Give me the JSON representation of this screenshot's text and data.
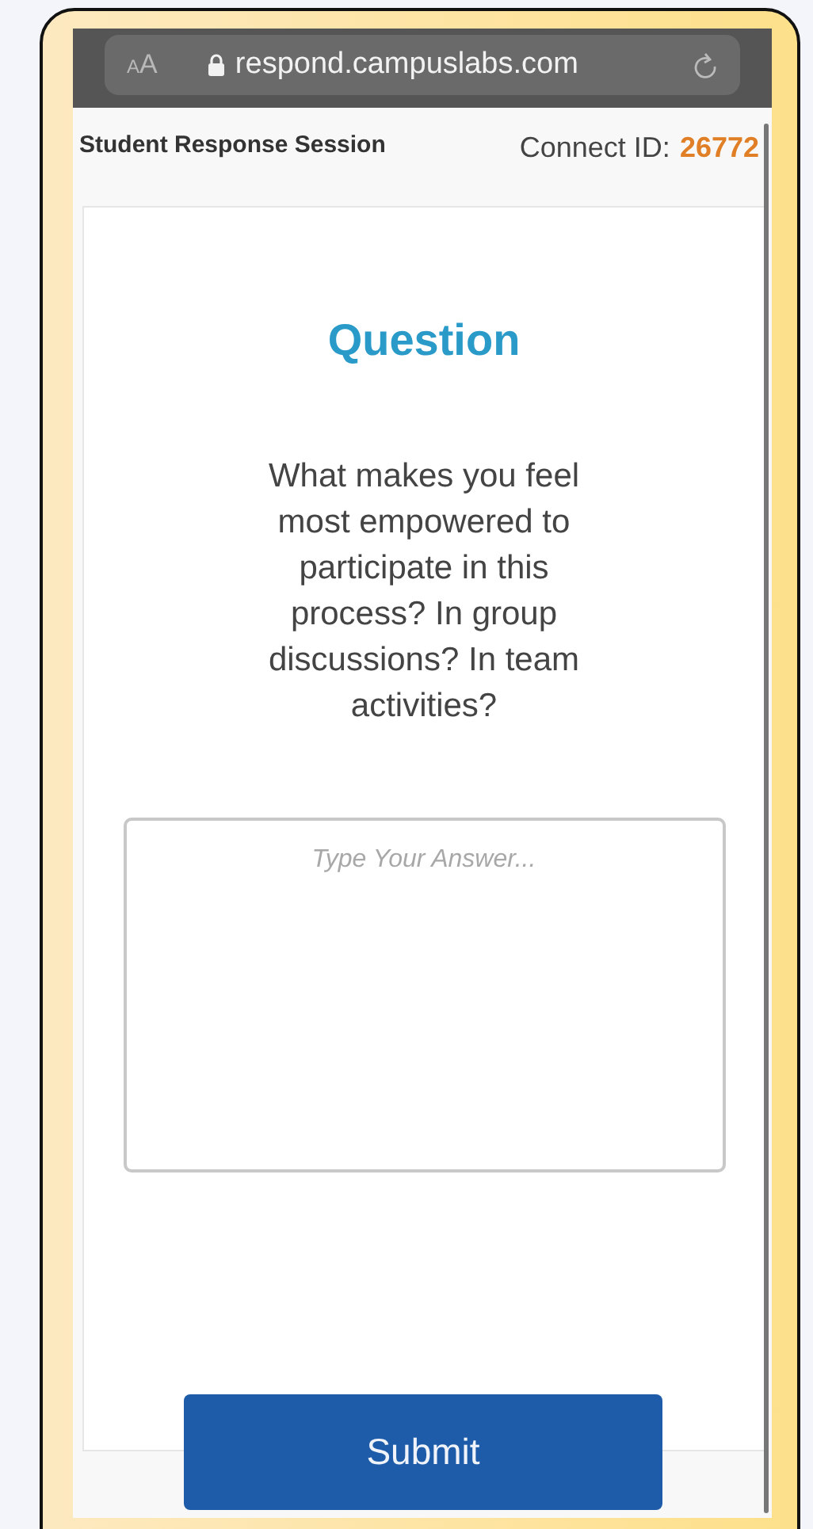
{
  "browser_bar": {
    "text_size_button": "AA",
    "url": "respond.campuslabs.com"
  },
  "header": {
    "title": "Student Response Session",
    "connect_label": "Connect ID:",
    "connect_id": "26772"
  },
  "question": {
    "heading": "Question",
    "text": "What makes you feel most empowered to participate in this process? In group discussions? In team activities?"
  },
  "answer": {
    "placeholder": "Type Your Answer..."
  },
  "submit_button": "Submit"
}
